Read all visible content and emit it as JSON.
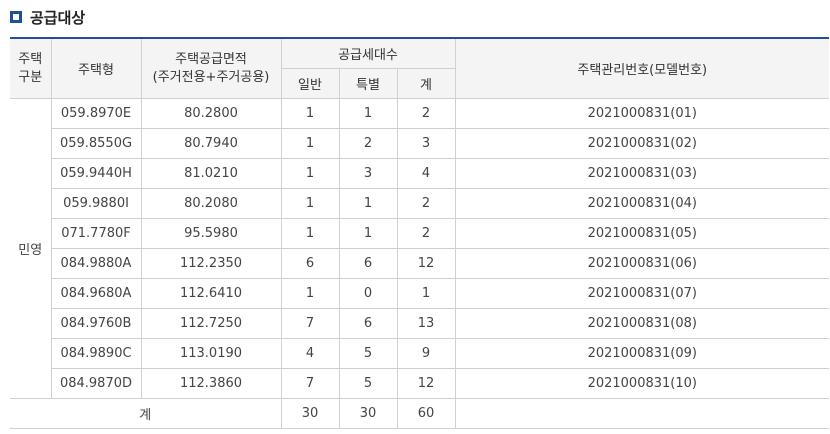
{
  "section": {
    "title": "공급대상"
  },
  "table": {
    "headers": {
      "house_type_category": [
        "주택",
        "구분"
      ],
      "house_type": "주택형",
      "supply_area": [
        "주택공급면적",
        "(주거전용+주거공용)"
      ],
      "supply_units": "공급세대수",
      "general": "일반",
      "special": "특별",
      "total": "계",
      "management_no": "주택관리번호(모델번호)"
    },
    "category": "민영",
    "rows": [
      {
        "type": "059.8970E",
        "area": "80.2800",
        "general": "1",
        "special": "1",
        "total": "2",
        "mgmt": "2021000831(01)"
      },
      {
        "type": "059.8550G",
        "area": "80.7940",
        "general": "1",
        "special": "2",
        "total": "3",
        "mgmt": "2021000831(02)"
      },
      {
        "type": "059.9440H",
        "area": "81.0210",
        "general": "1",
        "special": "3",
        "total": "4",
        "mgmt": "2021000831(03)"
      },
      {
        "type": "059.9880I",
        "area": "80.2080",
        "general": "1",
        "special": "1",
        "total": "2",
        "mgmt": "2021000831(04)"
      },
      {
        "type": "071.7780F",
        "area": "95.5980",
        "general": "1",
        "special": "1",
        "total": "2",
        "mgmt": "2021000831(05)"
      },
      {
        "type": "084.9880A",
        "area": "112.2350",
        "general": "6",
        "special": "6",
        "total": "12",
        "mgmt": "2021000831(06)"
      },
      {
        "type": "084.9680A",
        "area": "112.6410",
        "general": "1",
        "special": "0",
        "total": "1",
        "mgmt": "2021000831(07)"
      },
      {
        "type": "084.9760B",
        "area": "112.7250",
        "general": "7",
        "special": "6",
        "total": "13",
        "mgmt": "2021000831(08)"
      },
      {
        "type": "084.9890C",
        "area": "113.0190",
        "general": "4",
        "special": "5",
        "total": "9",
        "mgmt": "2021000831(09)"
      },
      {
        "type": "084.9870D",
        "area": "112.3860",
        "general": "7",
        "special": "5",
        "total": "12",
        "mgmt": "2021000831(10)"
      }
    ],
    "totals": {
      "label": "계",
      "general": "30",
      "special": "30",
      "total": "60"
    }
  }
}
